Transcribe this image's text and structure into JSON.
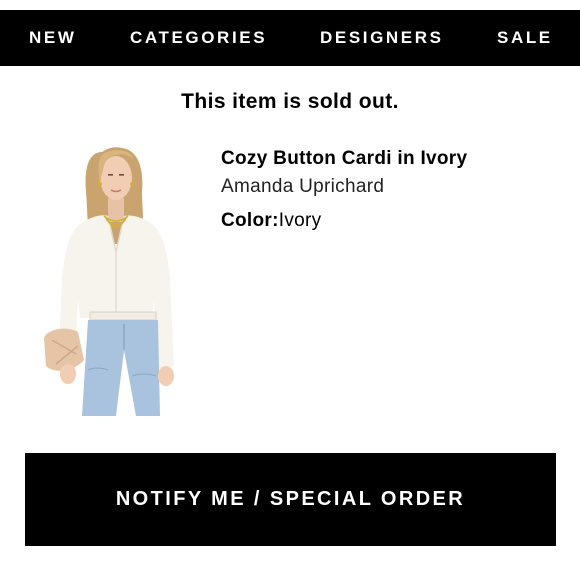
{
  "nav": {
    "items": [
      {
        "label": "NEW"
      },
      {
        "label": "CATEGORIES"
      },
      {
        "label": "DESIGNERS"
      },
      {
        "label": "SALE"
      }
    ]
  },
  "status": {
    "message": "This item is sold out."
  },
  "product": {
    "name": "Cozy Button Cardi in Ivory",
    "brand": "Amanda Uprichard",
    "color_label": "Color:",
    "color_value": "Ivory",
    "image_icon": "model-photo"
  },
  "cta": {
    "label": "NOTIFY ME / SPECIAL ORDER"
  },
  "colors": {
    "nav_bg": "#000000",
    "nav_text": "#ffffff",
    "button_bg": "#000000",
    "button_text": "#ffffff"
  }
}
